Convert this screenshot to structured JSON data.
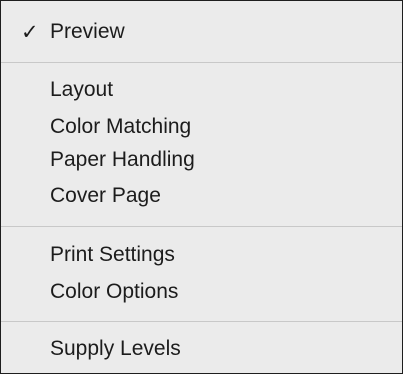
{
  "menu": {
    "checkmark": "✓",
    "items": [
      {
        "label": "Preview",
        "checked": true
      },
      {
        "label": "Layout"
      },
      {
        "label": "Color Matching"
      },
      {
        "label": "Paper Handling"
      },
      {
        "label": "Cover Page"
      },
      {
        "label": "Print Settings"
      },
      {
        "label": "Color Options"
      },
      {
        "label": "Supply Levels"
      }
    ]
  }
}
